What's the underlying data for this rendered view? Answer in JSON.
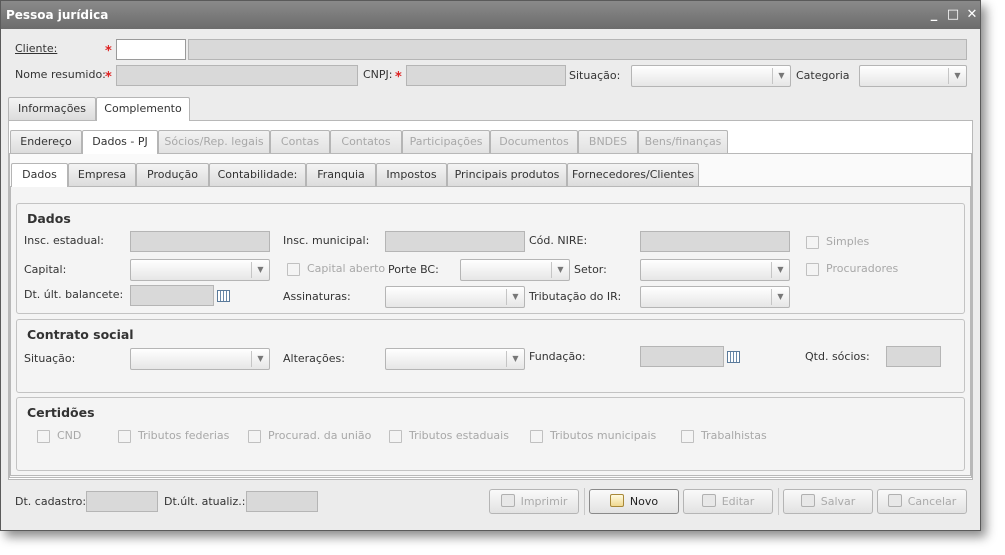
{
  "window": {
    "title": "Pessoa jurídica",
    "minimize": "_",
    "maximize": "□",
    "close": "✕"
  },
  "header": {
    "cliente_label": "Cliente:",
    "nome_label": "Nome resumido:",
    "cnpj_label": "CNPJ:",
    "situacao_label": "Situação:",
    "categoria_label": "Categoria",
    "required_mark": "*"
  },
  "tabs_top": [
    "Informações",
    "Complemento"
  ],
  "tabs_mid": [
    "Endereço",
    "Dados - PJ",
    "Sócios/Rep. legais",
    "Contas",
    "Contatos",
    "Participações",
    "Documentos",
    "BNDES",
    "Bens/finanças"
  ],
  "tabs_inner": [
    "Dados",
    "Empresa",
    "Produção",
    "Contabilidade:",
    "Franquia",
    "Impostos",
    "Principais produtos",
    "Fornecedores/Clientes"
  ],
  "dados": {
    "title": "Dados",
    "insc_estadual": "Insc. estadual:",
    "insc_municipal": "Insc. municipal:",
    "cod_nire": "Cód. NIRE:",
    "simples": "Simples",
    "capital": "Capital:",
    "capital_aberto": "Capital aberto",
    "porte_bc": "Porte BC:",
    "setor": "Setor:",
    "procuradores": "Procuradores",
    "dt_balancete": "Dt. últ. balancete:",
    "assinaturas": "Assinaturas:",
    "tributacao_ir": "Tributação do IR:"
  },
  "contrato": {
    "title": "Contrato social",
    "situacao": "Situação:",
    "alteracoes": "Alterações:",
    "fundacao": "Fundação:",
    "qtd_socios": "Qtd. sócios:"
  },
  "certidoes": {
    "title": "Certidões",
    "items": [
      "CND",
      "Tributos federias",
      "Procurad. da união",
      "Tributos estaduais",
      "Tributos municipais",
      "Trabalhistas"
    ]
  },
  "footer": {
    "dt_cadastro": "Dt. cadastro:",
    "dt_atualiz": "Dt.últ. atualiz.:",
    "buttons": {
      "imprimir": "Imprimir",
      "novo": "Novo",
      "editar": "Editar",
      "salvar": "Salvar",
      "cancelar": "Cancelar"
    }
  }
}
